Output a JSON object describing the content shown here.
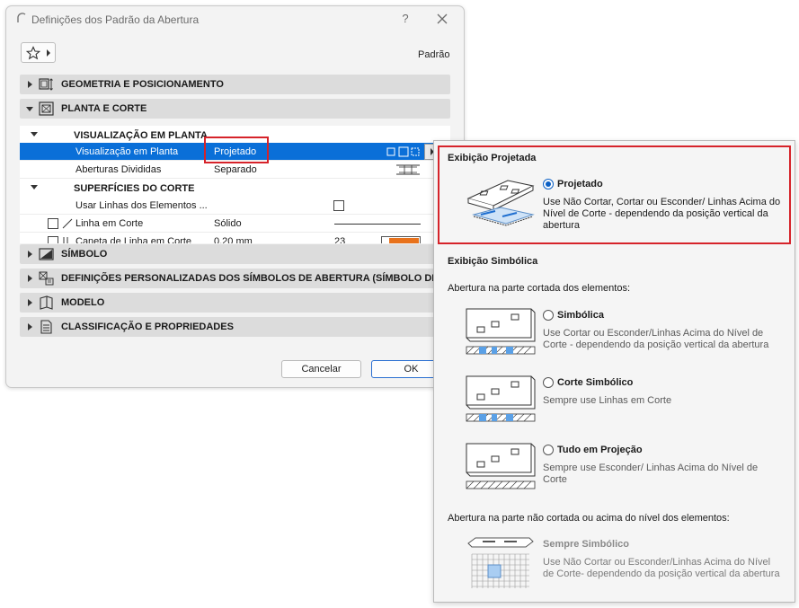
{
  "dialog": {
    "title": "Definições dos Padrão da Abertura",
    "help_label": "?",
    "favorites_label": "Padrão",
    "cancel_label": "Cancelar",
    "ok_label": "OK"
  },
  "sections": {
    "geometry": "GEOMETRIA E POSICIONAMENTO",
    "plan": "PLANTA E CORTE",
    "symbol": "SÍMBOLO",
    "custom": "DEFINIÇÕES PERSONALIZADAS DOS SÍMBOLOS DE ABERTURA  (SÍMBOLO DE CO",
    "model": "MODELO",
    "classification": "CLASSIFICAÇÃO E PROPRIEDADES"
  },
  "plan_panel": {
    "group_display": "VISUALIZAÇÃO EM PLANTA",
    "rows": [
      {
        "key": "Visualização em Planta",
        "value": "Projetado"
      },
      {
        "key": "Aberturas Divididas",
        "value": "Separado"
      }
    ],
    "group_surfaces": "SUPERFÍCIES DO CORTE",
    "surface_rows": [
      {
        "key": "Usar Linhas dos Elementos ...",
        "value": ""
      },
      {
        "key": "Linha em Corte",
        "value": "Sólido"
      },
      {
        "key": "Caneta de Linha em Corte",
        "value": "0,20 mm",
        "pen": "23"
      }
    ]
  },
  "popup": {
    "projected_title": "Exibição Projetada",
    "projected_option": "Projetado",
    "projected_desc": "Use Não Cortar, Cortar ou Esconder/ Linhas Acima do Nível de Corte - dependendo da posição vertical da abertura",
    "symbolic_title": "Exibição Simbólica",
    "cut_part_label": "Abertura na parte cortada dos elementos:",
    "options": [
      {
        "label": "Simbólica",
        "desc": "Use Cortar ou Esconder/Linhas Acima do Nível de Corte - dependendo da posição vertical da abertura"
      },
      {
        "label": "Corte Simbólico",
        "desc": "Sempre use Linhas em Corte"
      },
      {
        "label": "Tudo em Projeção",
        "desc": "Sempre use Esconder/ Linhas Acima do Nível de Corte"
      }
    ],
    "uncut_label": "Abertura na parte não cortada ou acima do nível dos elementos:",
    "always_label": "Sempre Simbólico",
    "always_desc": "Use Não Cortar ou Esconder/Linhas Acima do Nível de Corte- dependendo da posição vertical da abertura"
  },
  "colors": {
    "accent": "#0a6fd8",
    "highlight": "#d6232a",
    "pen_swatch": "#e8721c"
  }
}
